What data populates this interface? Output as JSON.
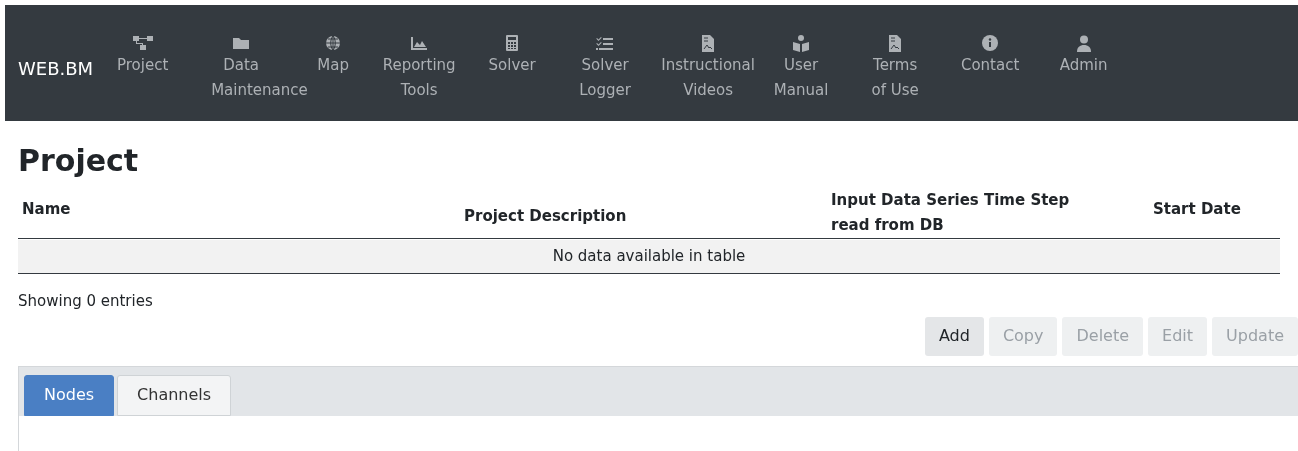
{
  "navbar": {
    "brand": "WEB.BM",
    "items": [
      {
        "label": "Project"
      },
      {
        "label": "Data Maintenance"
      },
      {
        "label": "Map"
      },
      {
        "label": "Reporting Tools"
      },
      {
        "label": "Solver"
      },
      {
        "label": "Solver Logger"
      },
      {
        "label": "Instructional Videos"
      },
      {
        "label": "User Manual"
      },
      {
        "label": "Terms of Use"
      },
      {
        "label": "Contact"
      },
      {
        "label": "Admin"
      }
    ]
  },
  "page_title": "Project",
  "table": {
    "columns": [
      "Name",
      "Project Description",
      "Input Data Series Time Step read from DB",
      "Start Date"
    ],
    "empty_message": "No data available in table"
  },
  "info": "Showing 0 entries",
  "buttons": [
    {
      "label": "Add",
      "disabled": false
    },
    {
      "label": "Copy",
      "disabled": true
    },
    {
      "label": "Delete",
      "disabled": true
    },
    {
      "label": "Edit",
      "disabled": true
    },
    {
      "label": "Update",
      "disabled": true
    }
  ],
  "tabs": [
    {
      "label": "Nodes",
      "selected": true
    },
    {
      "label": "Channels",
      "selected": false
    }
  ]
}
